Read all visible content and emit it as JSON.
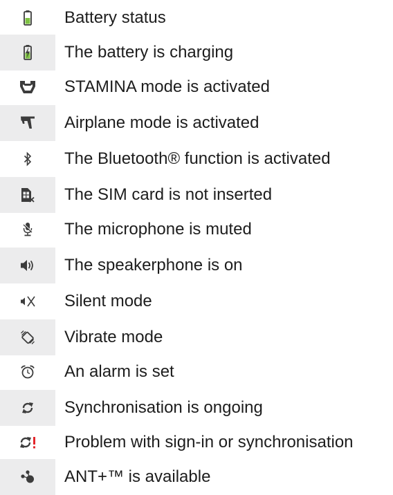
{
  "status_icons": {
    "items": [
      {
        "icon": "battery-status-icon",
        "label": "Battery status"
      },
      {
        "icon": "battery-charging-icon",
        "label": "The battery is charging"
      },
      {
        "icon": "stamina-mode-icon",
        "label": "STAMINA mode is activated"
      },
      {
        "icon": "airplane-mode-icon",
        "label": "Airplane mode is activated"
      },
      {
        "icon": "bluetooth-icon",
        "label": "The Bluetooth® function is activated"
      },
      {
        "icon": "no-sim-card-icon",
        "label": "The SIM card is not inserted"
      },
      {
        "icon": "microphone-muted-icon",
        "label": "The microphone is muted"
      },
      {
        "icon": "speakerphone-icon",
        "label": "The speakerphone is on"
      },
      {
        "icon": "silent-mode-icon",
        "label": "Silent mode"
      },
      {
        "icon": "vibrate-mode-icon",
        "label": "Vibrate mode"
      },
      {
        "icon": "alarm-icon",
        "label": "An alarm is set"
      },
      {
        "icon": "sync-icon",
        "label": "Synchronisation is ongoing"
      },
      {
        "icon": "sync-problem-icon",
        "label": "Problem with sign-in or synchronisation"
      },
      {
        "icon": "ant-plus-icon",
        "label": "ANT+™ is available"
      }
    ]
  },
  "colors": {
    "icon_gray": "#3c3c3c",
    "battery_green": "#7ec242",
    "warning_red": "#e3262b",
    "row_shade": "#ececed"
  }
}
